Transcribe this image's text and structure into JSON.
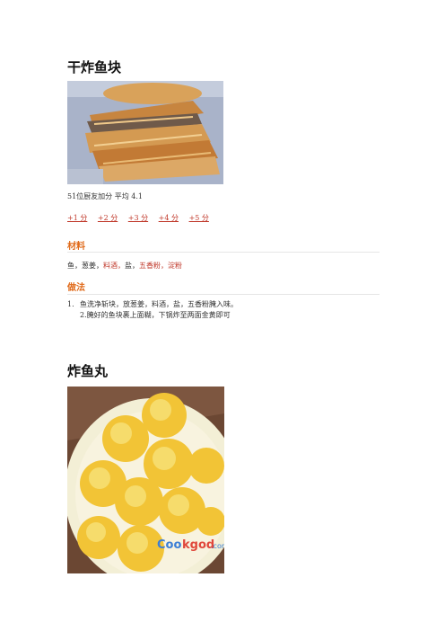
{
  "recipe1": {
    "title": "干炸鱼块",
    "rating": "51位厨友加分 平均 4.1",
    "votes": [
      "+1 分",
      "+2 分",
      "+3 分",
      "+4 分",
      "+5 分"
    ],
    "ingredients_heading": "材料",
    "ingredients": [
      "鱼，",
      "葱姜，",
      "料酒，",
      "盐，",
      "五香粉，",
      "淀粉"
    ],
    "method_heading": "做法",
    "steps": {
      "num": "1.",
      "line1": "鱼洗净斩块，放葱姜，料酒，盐，五香粉腌入味。",
      "line2": "2.腌好的鱼块裹上面糊，下锅炸至两面金黄即可"
    }
  },
  "recipe2": {
    "title": "炸鱼丸"
  },
  "colors": {
    "accent": "#e06a1a",
    "link": "#c0392b"
  }
}
